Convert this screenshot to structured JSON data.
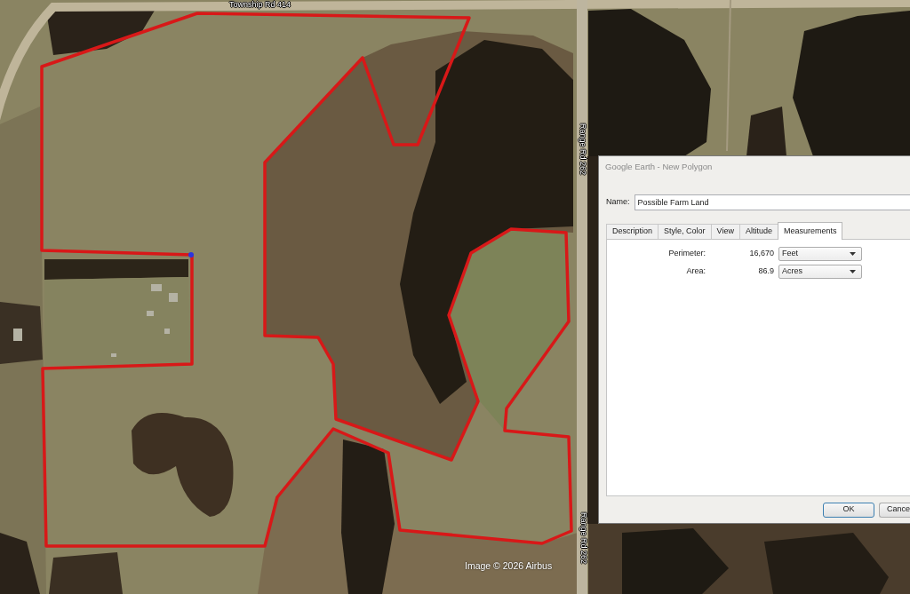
{
  "map": {
    "road_labels": [
      {
        "kind": "horizontal",
        "text": "Township Rd 414"
      },
      {
        "kind": "vertical",
        "text": "Range Rd 262"
      },
      {
        "kind": "vertical",
        "text": "Range Rd 262"
      }
    ],
    "attribution": "Image © 2026 Airbus"
  },
  "dialog": {
    "title": "Google Earth - New Polygon",
    "name_label": "Name:",
    "name_value": "Possible Farm Land",
    "tabs": [
      {
        "label": "Description",
        "selected": false
      },
      {
        "label": "Style, Color",
        "selected": false
      },
      {
        "label": "View",
        "selected": false
      },
      {
        "label": "Altitude",
        "selected": false
      },
      {
        "label": "Measurements",
        "selected": true
      }
    ],
    "measurements": [
      {
        "label": "Perimeter:",
        "value": "16,670",
        "unit": "Feet"
      },
      {
        "label": "Area:",
        "value": "86.9",
        "unit": "Acres"
      }
    ],
    "buttons": [
      {
        "label": "OK",
        "default": true
      },
      {
        "label": "Cance",
        "default": false
      }
    ]
  }
}
